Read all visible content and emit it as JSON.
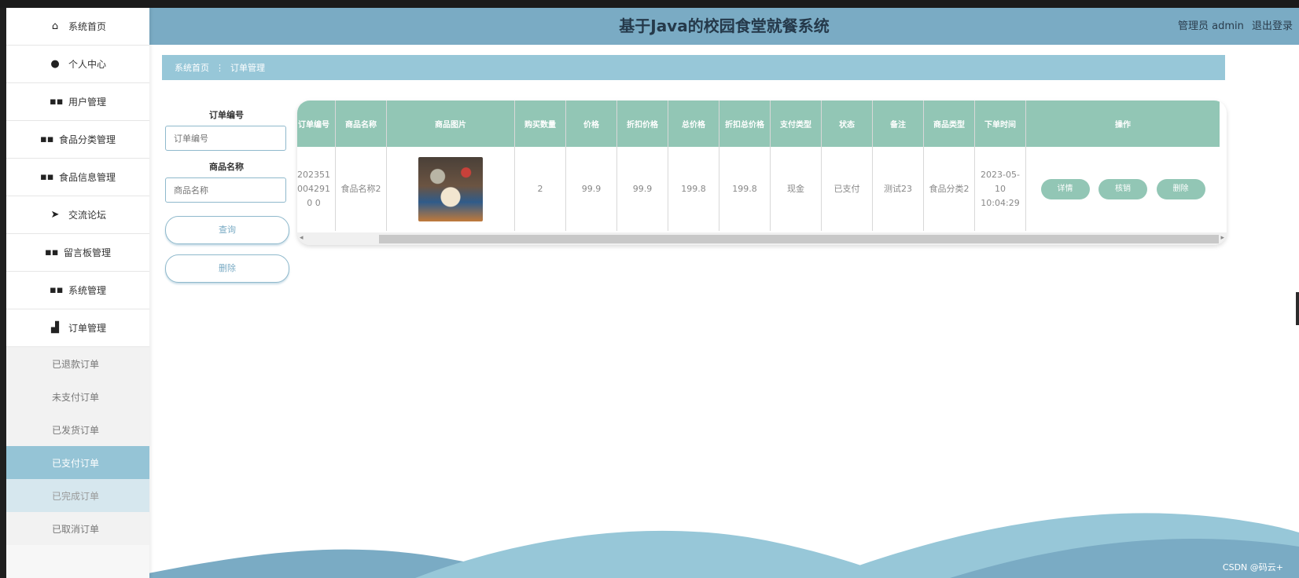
{
  "app": {
    "title": "基于Java的校园食堂就餐系统",
    "user_label": "管理员 admin",
    "logout_label": "退出登录"
  },
  "sidebar": {
    "items": [
      {
        "label": "系统首页",
        "icon": "home-icon"
      },
      {
        "label": "个人中心",
        "icon": "user-icon"
      },
      {
        "label": "用户管理",
        "icon": "grid-icon"
      },
      {
        "label": "食品分类管理",
        "icon": "grid-icon"
      },
      {
        "label": "食品信息管理",
        "icon": "grid-icon"
      },
      {
        "label": "交流论坛",
        "icon": "send-icon"
      },
      {
        "label": "留言板管理",
        "icon": "grid-icon"
      },
      {
        "label": "系统管理",
        "icon": "grid-icon"
      },
      {
        "label": "订单管理",
        "icon": "thumb-icon"
      }
    ],
    "subitems": [
      {
        "label": "已退款订单"
      },
      {
        "label": "未支付订单"
      },
      {
        "label": "已发货订单"
      },
      {
        "label": "已支付订单",
        "active": true
      },
      {
        "label": "已完成订单"
      },
      {
        "label": "已取消订单"
      }
    ]
  },
  "breadcrumb": {
    "home": "系统首页",
    "sep": "⋮",
    "current": "订单管理"
  },
  "search": {
    "order_no_label": "订单编号",
    "order_no_placeholder": "订单编号",
    "product_name_label": "商品名称",
    "product_name_placeholder": "商品名称",
    "query_button": "查询",
    "delete_button": "删除"
  },
  "table": {
    "headers": [
      "订单编号",
      "商品名称",
      "商品图片",
      "购买数量",
      "价格",
      "折扣价格",
      "总价格",
      "折扣总价格",
      "支付类型",
      "状态",
      "备注",
      "商品类型",
      "下单时间",
      "操作"
    ],
    "rows": [
      {
        "order_no": "2023510042910 0",
        "product_name": "食品名称2",
        "quantity": "2",
        "price": "99.9",
        "discount_price": "99.9",
        "total_price": "199.8",
        "discount_total": "199.8",
        "pay_type": "现金",
        "status": "已支付",
        "remark": "测试23",
        "product_type": "食品分类2",
        "order_time": "2023-05-10 10:04:29"
      }
    ],
    "actions": {
      "detail": "详情",
      "ship": "核销",
      "delete": "删除"
    }
  },
  "watermark": "CSDN @码云+",
  "colors": {
    "header": "#7aabc4",
    "breadcrumb": "#97c7d8",
    "table_header": "#92c6b5",
    "active_menu": "#95c4d6"
  }
}
